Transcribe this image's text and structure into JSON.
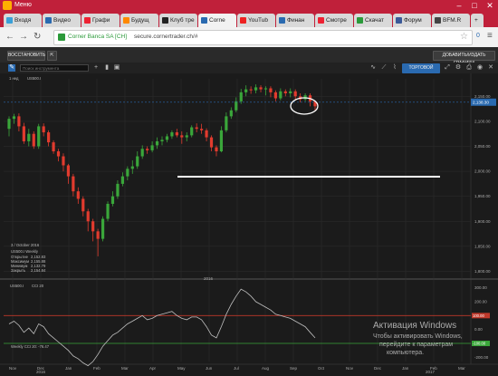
{
  "window": {
    "title": "Меню"
  },
  "tabs": [
    {
      "label": "Входя",
      "color": "#3aa0d8"
    },
    {
      "label": "Видео",
      "color": "#2a6ab0"
    },
    {
      "label": "Графи",
      "color": "#e23"
    },
    {
      "label": "Будущ",
      "color": "#f80"
    },
    {
      "label": "Клуб тре",
      "color": "#222"
    },
    {
      "label": "Corne",
      "color": "#2a6ab0",
      "active": true
    },
    {
      "label": "YouTub",
      "color": "#e22"
    },
    {
      "label": "Финан",
      "color": "#2a6ab0"
    },
    {
      "label": "Смотре",
      "color": "#e23"
    },
    {
      "label": "Скачат",
      "color": "#2b9a3a"
    },
    {
      "label": "Форум",
      "color": "#3b5998"
    },
    {
      "label": "BFM.R",
      "color": "#444"
    }
  ],
  "address": {
    "site": "Corner Banca SA [CH]",
    "url": "secure.cornertrader.ch/#",
    "badge": "0"
  },
  "toolbar": {
    "restore": "ВОССТАНОВИТЬ",
    "add_charts": "ДОБАВИТЬ/ИЗДАТЬ ГРАФИКИ"
  },
  "chart_toolbar": {
    "search_placeholder": "Поиск инструмента",
    "trade_button": "ТОРГОВОЙ"
  },
  "instrument": {
    "label": "1 нед",
    "symbol": "US500.I"
  },
  "crosshair": {
    "date": "3 / October 2016"
  },
  "ohlc": {
    "title": "US500.I Weekly",
    "rows": [
      {
        "k": "Открытие",
        "v": "2,152.83"
      },
      {
        "k": "Максимум",
        "v": "2,155.88"
      },
      {
        "k": "Минимум",
        "v": "2,132.79"
      },
      {
        "k": "Закрыть",
        "v": "2,154.84"
      }
    ]
  },
  "price_label": {
    "text": "2,138.30",
    "color": "#2a6ab0"
  },
  "cci": {
    "title": "US500.I",
    "params": "CCI 20",
    "status": "Weekly\nCCI 20: -76.47",
    "last_label": "-100.00",
    "marks": {
      "upper": "100.00",
      "lower": "-100.00"
    }
  },
  "watermark": {
    "line1": "Активация Windows",
    "line2": "Чтобы активировать Windows,",
    "line3": "перейдите к параметрам",
    "line4": "компьютера."
  },
  "chart_data": {
    "type": "candlestick",
    "price_ticks": [
      "2,150.00",
      "2,100.00",
      "2,050.00",
      "2,000.00",
      "1,950.00",
      "1,900.00",
      "1,850.00",
      "1,800.00"
    ],
    "time_ticks": [
      "Nov",
      "Dec",
      "Jan",
      "Feb",
      "Mar",
      "Apr",
      "May",
      "Jun",
      "Jul",
      "Aug",
      "Sep",
      "Oct",
      "Nov",
      "Dec",
      "Jan",
      "Feb",
      "Mar"
    ],
    "year_marks": [
      "2016",
      "2017"
    ],
    "cci_ticks": [
      "300.00",
      "200.00",
      "100.00",
      "0.00",
      "-100.00",
      "-200.00"
    ],
    "current_price": 2138.3,
    "candles": [
      [
        2085,
        2105,
        2070,
        2110
      ],
      [
        2105,
        2110,
        2095,
        2115
      ],
      [
        2110,
        2090,
        2080,
        2116
      ],
      [
        2090,
        2060,
        2055,
        2097
      ],
      [
        2060,
        2075,
        2050,
        2085
      ],
      [
        2075,
        2050,
        2045,
        2080
      ],
      [
        2050,
        2090,
        2045,
        2095
      ],
      [
        2090,
        2078,
        2070,
        2096
      ],
      [
        2078,
        2058,
        2050,
        2082
      ],
      [
        2058,
        2040,
        2035,
        2062
      ],
      [
        2040,
        2030,
        2020,
        2045
      ],
      [
        2030,
        2012,
        2000,
        2036
      ],
      [
        2012,
        1990,
        1975,
        2015
      ],
      [
        1990,
        1960,
        1950,
        1995
      ],
      [
        1960,
        1945,
        1935,
        1968
      ],
      [
        1945,
        1920,
        1910,
        1950
      ],
      [
        1920,
        1900,
        1880,
        1925
      ],
      [
        1900,
        1880,
        1860,
        1905
      ],
      [
        1880,
        1865,
        1830,
        1885
      ],
      [
        1865,
        1905,
        1860,
        1910
      ],
      [
        1905,
        1935,
        1900,
        1940
      ],
      [
        1935,
        1950,
        1930,
        1960
      ],
      [
        1950,
        1975,
        1945,
        1982
      ],
      [
        1975,
        1990,
        1970,
        1998
      ],
      [
        1990,
        2005,
        1982,
        2010
      ],
      [
        2005,
        2010,
        1995,
        2022
      ],
      [
        2010,
        2030,
        2005,
        2040
      ],
      [
        2030,
        2045,
        2025,
        2052
      ],
      [
        2045,
        2042,
        2035,
        2050
      ],
      [
        2042,
        2052,
        2038,
        2060
      ],
      [
        2052,
        2060,
        2045,
        2068
      ],
      [
        2060,
        2063,
        2052,
        2070
      ],
      [
        2063,
        2070,
        2058,
        2075
      ],
      [
        2070,
        2078,
        2065,
        2082
      ],
      [
        2078,
        2072,
        2068,
        2085
      ],
      [
        2072,
        2068,
        2055,
        2080
      ],
      [
        2068,
        2072,
        2060,
        2078
      ],
      [
        2072,
        2088,
        2068,
        2092
      ],
      [
        2088,
        2085,
        2078,
        2096
      ],
      [
        2085,
        2082,
        2075,
        2095
      ],
      [
        2082,
        2068,
        2060,
        2086
      ],
      [
        2068,
        2048,
        2040,
        2072
      ],
      [
        2048,
        2040,
        2030,
        2052
      ],
      [
        2040,
        2082,
        2038,
        2090
      ],
      [
        2082,
        2110,
        2078,
        2118
      ],
      [
        2110,
        2122,
        2105,
        2128
      ],
      [
        2122,
        2140,
        2118,
        2148
      ],
      [
        2140,
        2158,
        2135,
        2165
      ],
      [
        2158,
        2164,
        2150,
        2172
      ],
      [
        2164,
        2162,
        2155,
        2170
      ],
      [
        2162,
        2168,
        2156,
        2174
      ],
      [
        2168,
        2164,
        2158,
        2172
      ],
      [
        2164,
        2166,
        2152,
        2170
      ],
      [
        2166,
        2158,
        2148,
        2170
      ],
      [
        2158,
        2146,
        2140,
        2162
      ],
      [
        2146,
        2160,
        2142,
        2166
      ],
      [
        2160,
        2156,
        2150,
        2164
      ],
      [
        2156,
        2160,
        2148,
        2166
      ],
      [
        2160,
        2150,
        2142,
        2164
      ],
      [
        2150,
        2144,
        2138,
        2156
      ],
      [
        2144,
        2152,
        2140,
        2156
      ],
      [
        2152,
        2140,
        2130,
        2156
      ],
      [
        2140,
        2130,
        2122,
        2142
      ]
    ],
    "cci": [
      40,
      60,
      30,
      -20,
      10,
      -30,
      40,
      20,
      -30,
      -60,
      -90,
      -120,
      -150,
      -190,
      -210,
      -240,
      -260,
      -230,
      -180,
      -120,
      -80,
      -40,
      -20,
      10,
      40,
      60,
      80,
      100,
      70,
      80,
      100,
      110,
      120,
      130,
      100,
      80,
      70,
      90,
      90,
      70,
      20,
      -40,
      -60,
      20,
      110,
      180,
      240,
      290,
      270,
      240,
      200,
      180,
      160,
      140,
      110,
      100,
      90,
      80,
      60,
      40,
      20,
      -20,
      -60
    ]
  },
  "colors": {
    "up": "#3aa63a",
    "down": "#e23b2e",
    "background": "#1b1b1b",
    "grid": "#2e2e2e",
    "cci_line": "#bfbfbf",
    "cci_upper": "#c0392b",
    "cci_lower": "#3aa63a",
    "annotation": "#ffffff"
  }
}
